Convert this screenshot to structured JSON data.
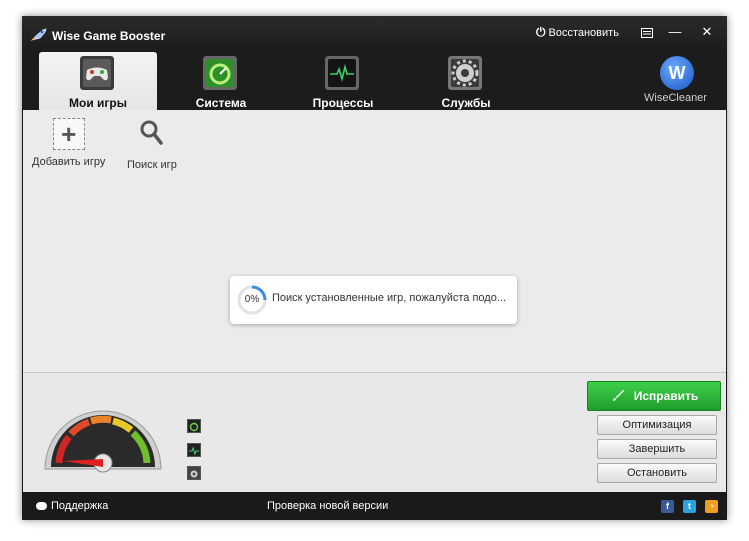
{
  "window": {
    "title": "Wise Game Booster",
    "restore_label": "Восстановить",
    "controls": {
      "menu_icon": "menu-icon",
      "minimize": "—",
      "close": "✕"
    }
  },
  "tabs": [
    {
      "label": "Мои игры",
      "icon": "gamepad-icon",
      "active": true
    },
    {
      "label": "Система",
      "icon": "system-gauge-icon",
      "active": false
    },
    {
      "label": "Процессы",
      "icon": "heartbeat-monitor-icon",
      "active": false
    },
    {
      "label": "Службы",
      "icon": "gear-icon",
      "active": false
    }
  ],
  "brand": {
    "logo_letter": "W",
    "label": "WiseCleaner"
  },
  "toolbar": {
    "add_game_label": "Добавить игру",
    "search_games_label": "Поиск игр"
  },
  "progress": {
    "percent_text": "0%",
    "percent": 0,
    "message": "Поиск установленные игр, пожалуйста подо..."
  },
  "actions": {
    "fix_label": "Исправить",
    "optimize_label": "Оптимизация",
    "finish_label": "Завершить",
    "stop_label": "Остановить"
  },
  "status": {
    "support_label": "Поддержка",
    "update_label": "Проверка новой версии",
    "social": [
      "facebook-icon",
      "twitter-icon",
      "rss-icon"
    ]
  },
  "colors": {
    "accent_green": "#2fba3c",
    "titlebar": "#1c1c1c",
    "content_bg": "#ebebeb"
  }
}
